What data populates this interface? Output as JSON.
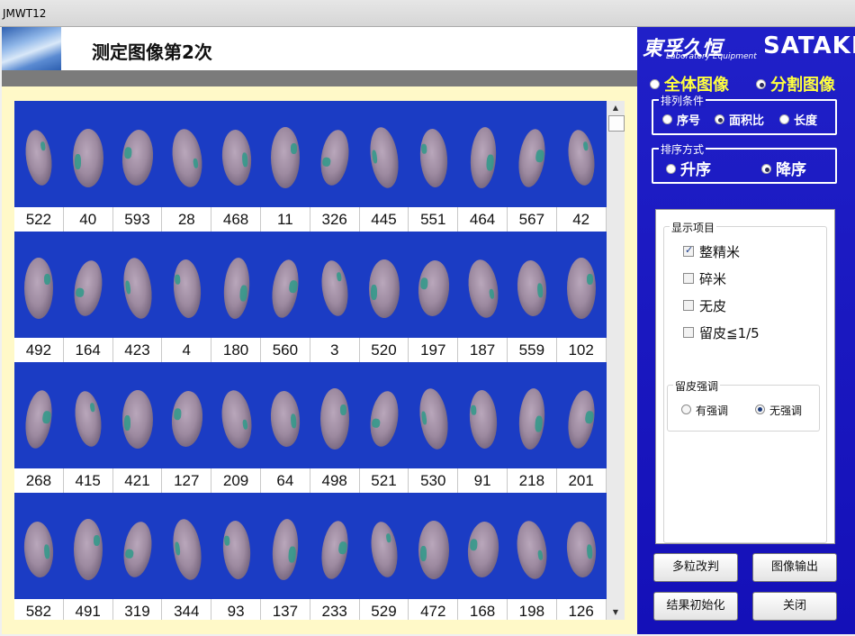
{
  "window": {
    "title": "JMWT12"
  },
  "header": {
    "title": "测定图像第2次"
  },
  "brand": {
    "cn": "東孚久恒",
    "sub": "Laboratory Equipment",
    "en": "SATAKE"
  },
  "mode": {
    "options": [
      {
        "label": "全体图像",
        "selected": false
      },
      {
        "label": "分割图像",
        "selected": true
      }
    ]
  },
  "sort_condition": {
    "label": "排列条件",
    "options": [
      {
        "label": "序号",
        "selected": false
      },
      {
        "label": "面积比",
        "selected": true
      },
      {
        "label": "长度",
        "selected": false
      }
    ]
  },
  "sort_order": {
    "label": "排序方式",
    "options": [
      {
        "label": "升序",
        "selected": false
      },
      {
        "label": "降序",
        "selected": true
      }
    ]
  },
  "display_items": {
    "label": "显示项目",
    "items": [
      {
        "label": "整精米",
        "checked": true
      },
      {
        "label": "碎米",
        "checked": false
      },
      {
        "label": "无皮",
        "checked": false
      },
      {
        "label": "留皮≦1/5",
        "checked": false
      }
    ]
  },
  "emphasis": {
    "label": "留皮强调",
    "options": [
      {
        "label": "有强调",
        "selected": false
      },
      {
        "label": "无强调",
        "selected": true
      }
    ]
  },
  "buttons": {
    "multi_judge": "多粒改判",
    "image_output": "图像输出",
    "reset_results": "结果初始化",
    "close": "关闭"
  },
  "grid": {
    "rows": [
      [
        "522",
        "40",
        "593",
        "28",
        "468",
        "11",
        "326",
        "445",
        "551",
        "464",
        "567",
        "42"
      ],
      [
        "492",
        "164",
        "423",
        "4",
        "180",
        "560",
        "3",
        "520",
        "197",
        "187",
        "559",
        "102"
      ],
      [
        "268",
        "415",
        "421",
        "127",
        "209",
        "64",
        "498",
        "521",
        "530",
        "91",
        "218",
        "201"
      ],
      [
        "582",
        "491",
        "319",
        "344",
        "93",
        "137",
        "233",
        "529",
        "472",
        "168",
        "198",
        "126"
      ]
    ]
  },
  "colors": {
    "grid_bg": "#1b3cc4",
    "panel_bg": "#1d1cc4",
    "mode_text": "#ffff40",
    "frame": "#fff9c8"
  }
}
